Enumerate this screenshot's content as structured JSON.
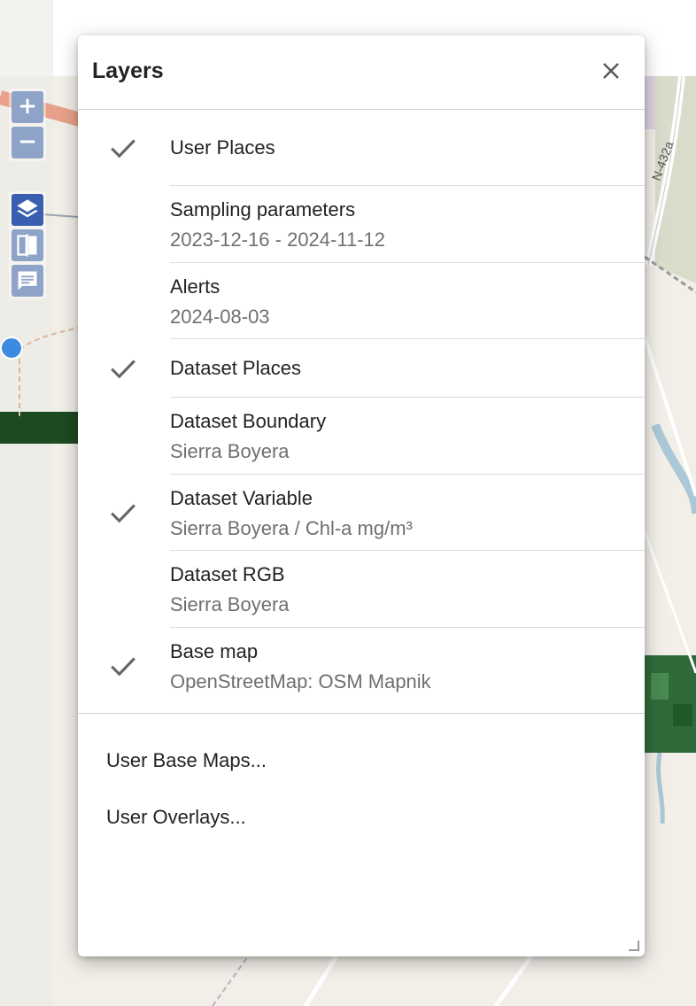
{
  "panel": {
    "title": "Layers",
    "close_icon": "close-icon"
  },
  "layers": [
    {
      "title": "User Places",
      "subtitle": "",
      "checked": true
    },
    {
      "title": "Sampling parameters",
      "subtitle": "2023-12-16 - 2024-11-12",
      "checked": false
    },
    {
      "title": "Alerts",
      "subtitle": "2024-08-03",
      "checked": false
    },
    {
      "title": "Dataset Places",
      "subtitle": "",
      "checked": true
    },
    {
      "title": "Dataset Boundary",
      "subtitle": "Sierra Boyera",
      "checked": false
    },
    {
      "title": "Dataset Variable",
      "subtitle": "Sierra Boyera / Chl-a mg/m³",
      "checked": true
    },
    {
      "title": "Dataset RGB",
      "subtitle": "Sierra Boyera",
      "checked": false
    },
    {
      "title": "Base map",
      "subtitle": "OpenStreetMap: OSM Mapnik",
      "checked": true
    }
  ],
  "menu": {
    "user_base_maps": "User Base Maps...",
    "user_overlays": "User Overlays..."
  },
  "map_controls": {
    "zoom_in": "+",
    "zoom_out": "−",
    "tools": [
      "layers-icon",
      "compare-icon",
      "chat-icon"
    ]
  },
  "map_labels": {
    "road": "N-432a"
  },
  "colors": {
    "accent": "#3a5fb0",
    "control": "#8ea3c8",
    "check": "#666666"
  }
}
